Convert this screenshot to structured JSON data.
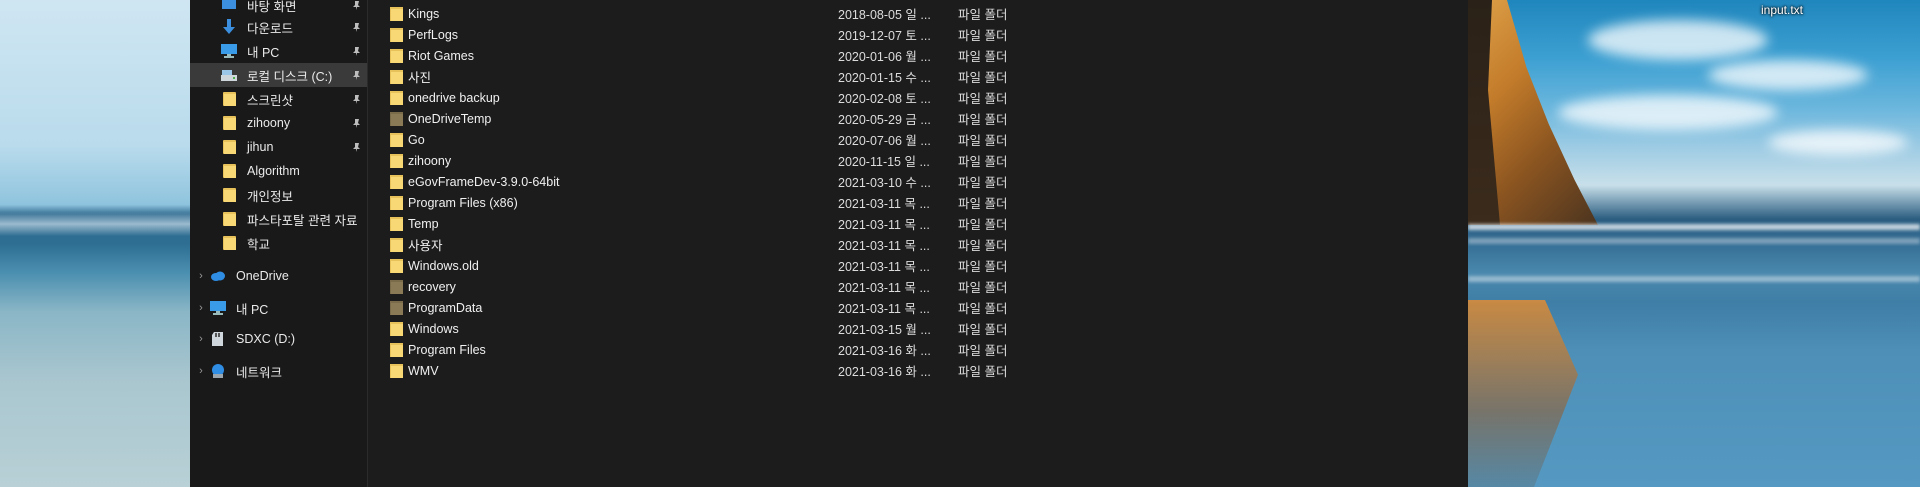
{
  "desktop": {
    "file_label": "input.txt"
  },
  "nav": {
    "items": [
      {
        "label": "바탕 화면",
        "icon": "desktop-icon",
        "pinned": true
      },
      {
        "label": "다운로드",
        "icon": "download-icon",
        "pinned": true
      },
      {
        "label": "내 PC",
        "icon": "monitor-icon",
        "pinned": true
      },
      {
        "label": "로컬 디스크 (C:)",
        "icon": "drive-icon",
        "pinned": true,
        "selected": true
      },
      {
        "label": "스크린샷",
        "icon": "folder-icon",
        "pinned": true
      },
      {
        "label": "zihoony",
        "icon": "folder-icon",
        "pinned": true
      },
      {
        "label": "jihun",
        "icon": "folder-icon",
        "pinned": true
      },
      {
        "label": "Algorithm",
        "icon": "folder-icon",
        "pinned": false
      },
      {
        "label": "개인정보",
        "icon": "folder-icon",
        "pinned": false
      },
      {
        "label": "파스타포탈 관련 자료",
        "icon": "folder-icon",
        "pinned": false
      },
      {
        "label": "학교",
        "icon": "folder-icon",
        "pinned": false
      }
    ],
    "roots": [
      {
        "label": "OneDrive",
        "icon": "cloud-icon"
      },
      {
        "label": "내 PC",
        "icon": "monitor-icon"
      },
      {
        "label": "SDXC (D:)",
        "icon": "sd-card-icon"
      },
      {
        "label": "네트워크",
        "icon": "network-icon"
      }
    ]
  },
  "files": [
    {
      "name": "Kings",
      "date": "2018-08-05 일 ...",
      "type": "파일 폴더"
    },
    {
      "name": "PerfLogs",
      "date": "2019-12-07 토 ...",
      "type": "파일 폴더"
    },
    {
      "name": "Riot Games",
      "date": "2020-01-06 월 ...",
      "type": "파일 폴더"
    },
    {
      "name": "사진",
      "date": "2020-01-15 수 ...",
      "type": "파일 폴더"
    },
    {
      "name": "onedrive backup",
      "date": "2020-02-08 토 ...",
      "type": "파일 폴더"
    },
    {
      "name": "OneDriveTemp",
      "date": "2020-05-29 금 ...",
      "type": "파일 폴더"
    },
    {
      "name": "Go",
      "date": "2020-07-06 월 ...",
      "type": "파일 폴더"
    },
    {
      "name": "zihoony",
      "date": "2020-11-15 일 ...",
      "type": "파일 폴더"
    },
    {
      "name": "eGovFrameDev-3.9.0-64bit",
      "date": "2021-03-10 수 ...",
      "type": "파일 폴더"
    },
    {
      "name": "Program Files (x86)",
      "date": "2021-03-11 목 ...",
      "type": "파일 폴더"
    },
    {
      "name": "Temp",
      "date": "2021-03-11 목 ...",
      "type": "파일 폴더"
    },
    {
      "name": "사용자",
      "date": "2021-03-11 목 ...",
      "type": "파일 폴더"
    },
    {
      "name": "Windows.old",
      "date": "2021-03-11 목 ...",
      "type": "파일 폴더"
    },
    {
      "name": "recovery",
      "date": "2021-03-11 목 ...",
      "type": "파일 폴더"
    },
    {
      "name": "ProgramData",
      "date": "2021-03-11 목 ...",
      "type": "파일 폴더"
    },
    {
      "name": "Windows",
      "date": "2021-03-15 월 ...",
      "type": "파일 폴더"
    },
    {
      "name": "Program Files",
      "date": "2021-03-16 화 ...",
      "type": "파일 폴더"
    },
    {
      "name": "WMV",
      "date": "2021-03-16 화 ...",
      "type": "파일 폴더"
    }
  ],
  "colors": {
    "folder": "#f8d775",
    "folder_hidden": "#8a7a55",
    "window_bg": "#191919",
    "selected_bg": "#3a3a3a"
  }
}
